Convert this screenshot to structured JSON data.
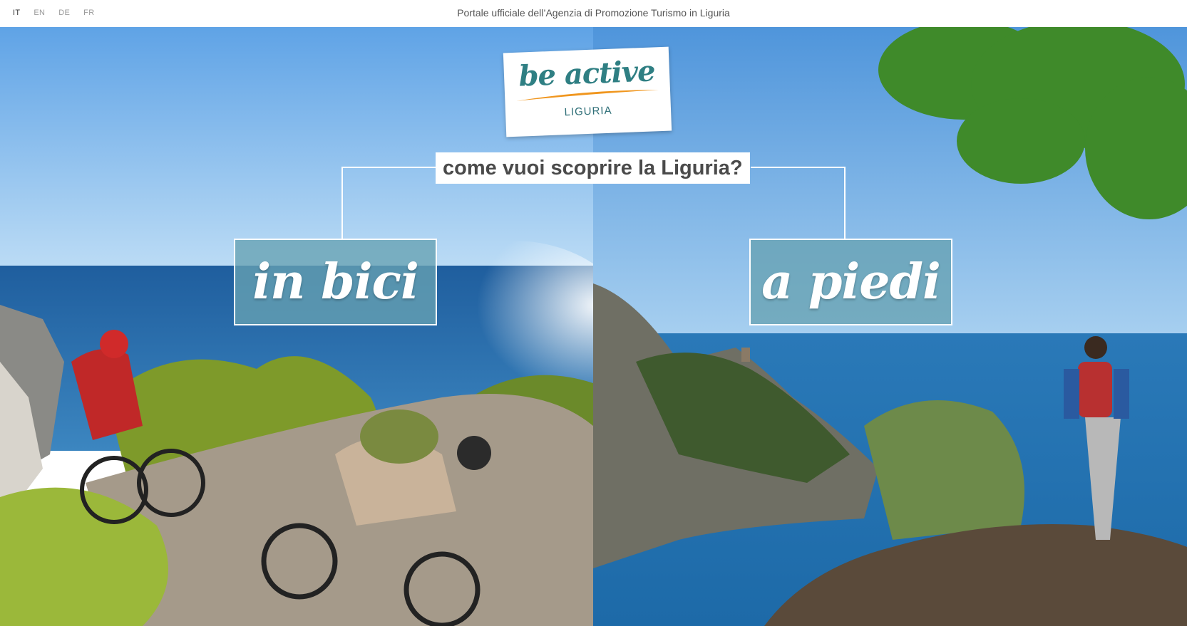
{
  "languages": [
    {
      "code": "IT",
      "active": true
    },
    {
      "code": "EN",
      "active": false
    },
    {
      "code": "DE",
      "active": false
    },
    {
      "code": "FR",
      "active": false
    }
  ],
  "header": {
    "tagline": "Portale ufficiale dell’Agenzia di Promozione Turismo in Liguria"
  },
  "logo": {
    "main_text": "be active",
    "sub_text": "LIGURIA"
  },
  "hero": {
    "question": "come vuoi scoprire la Liguria?",
    "choices": [
      {
        "label": "in bici"
      },
      {
        "label": "a piedi"
      }
    ]
  },
  "colors": {
    "accent_teal": "#2f7f83",
    "swoosh_orange": "#f0961e",
    "choice_box": "#66a2b2"
  }
}
